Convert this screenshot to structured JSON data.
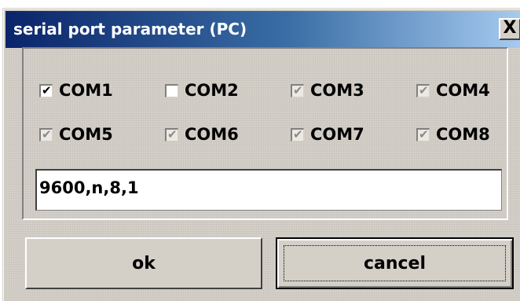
{
  "window": {
    "title": "serial port parameter (PC)",
    "close_label": "X"
  },
  "checkboxes": [
    {
      "label": "COM1",
      "checked": true,
      "disabled": false
    },
    {
      "label": "COM2",
      "checked": false,
      "disabled": false
    },
    {
      "label": "COM3",
      "checked": true,
      "disabled": true
    },
    {
      "label": "COM4",
      "checked": true,
      "disabled": true
    },
    {
      "label": "COM5",
      "checked": true,
      "disabled": true
    },
    {
      "label": "COM6",
      "checked": true,
      "disabled": true
    },
    {
      "label": "COM7",
      "checked": true,
      "disabled": true
    },
    {
      "label": "COM8",
      "checked": true,
      "disabled": true
    }
  ],
  "settings_field": {
    "value": "9600,n,8,1"
  },
  "buttons": {
    "ok": "ok",
    "cancel": "cancel"
  },
  "colors": {
    "title_gradient_start": "#0a246a",
    "title_gradient_end": "#a6caf0",
    "face": "#d4d0c8"
  }
}
